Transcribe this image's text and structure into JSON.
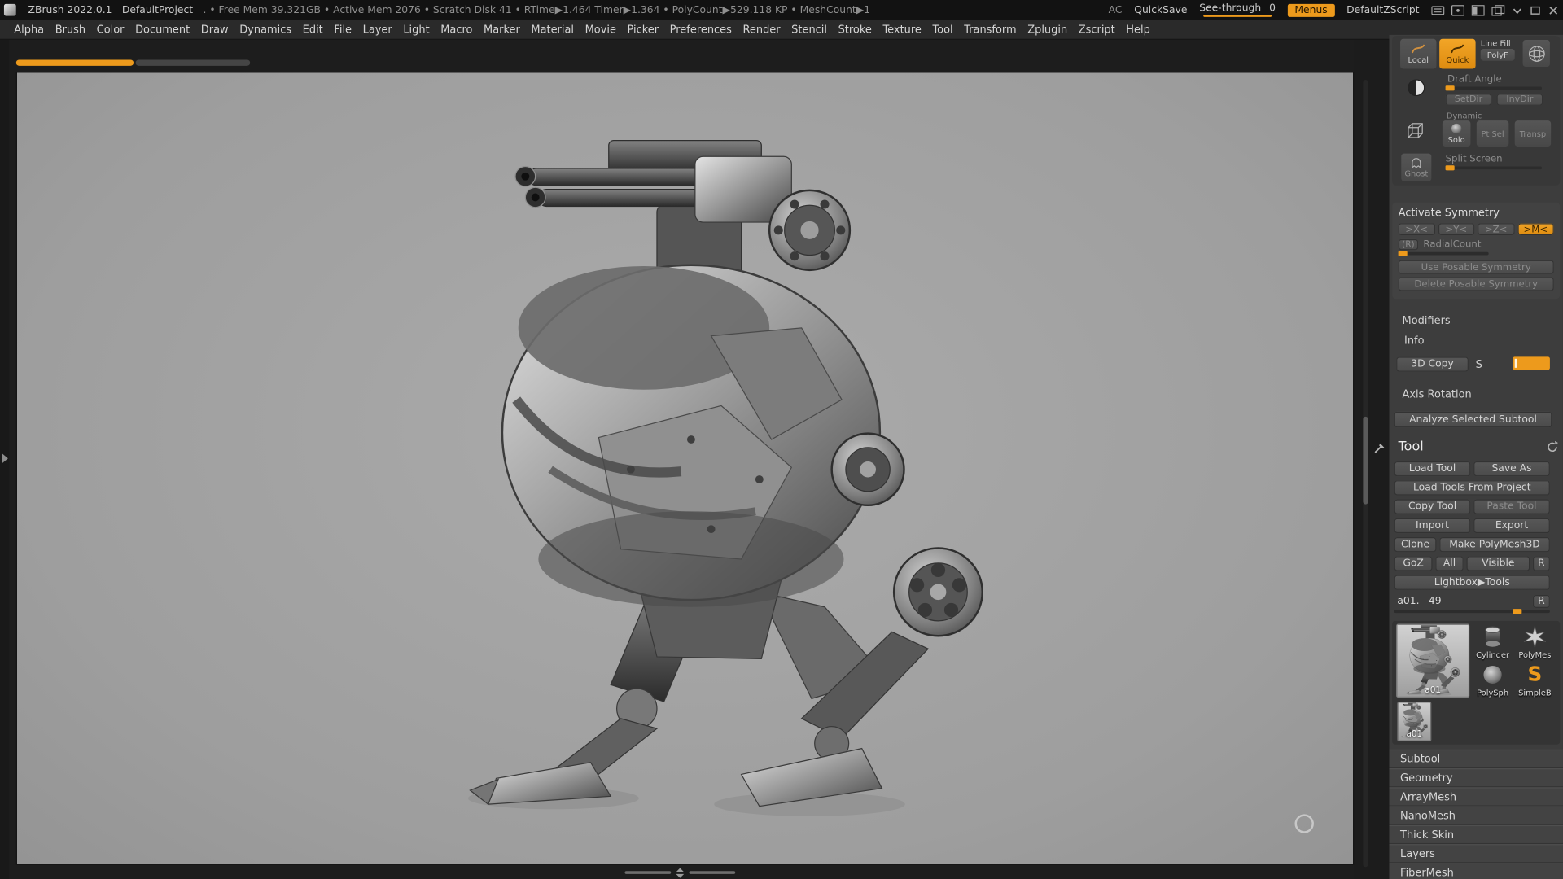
{
  "titlebar": {
    "app_title": "ZBrush 2022.0.1",
    "project_name": "DefaultProject",
    "stats": ". • Free Mem 39.321GB • Active Mem 2076 • Scratch Disk 41 •  RTime▶1.464 Timer▶1.364 • PolyCount▶529.118 KP  • MeshCount▶1",
    "ac_label": "AC",
    "quicksave_label": "QuickSave",
    "seethrough_label": "See-through",
    "seethrough_value": "0",
    "menus_label": "Menus",
    "zscript_label": "DefaultZScript"
  },
  "menubar": {
    "items": [
      "Alpha",
      "Brush",
      "Color",
      "Document",
      "Draw",
      "Dynamics",
      "Edit",
      "File",
      "Layer",
      "Light",
      "Macro",
      "Marker",
      "Material",
      "Movie",
      "Picker",
      "Preferences",
      "Render",
      "Stencil",
      "Stroke",
      "Texture",
      "Tool",
      "Transform",
      "Zplugin",
      "Zscript",
      "Help"
    ]
  },
  "shelf": {
    "local_label": "Local",
    "quick_label": "Quick",
    "line_fill_label": "Line Fill",
    "polyf_label": "PolyF",
    "draft_angle_label": "Draft Angle",
    "setdir_label": "SetDir",
    "invdir_label": "InvDir",
    "dynamic_label": "Dynamic",
    "solo_label": "Solo",
    "ptsel_label": "Pt Sel",
    "transp_label": "Transp",
    "split_screen_label": "Split Screen",
    "ghost_label": "Ghost"
  },
  "symmetry": {
    "header": "Activate Symmetry",
    "x_label": ">X<",
    "y_label": ">Y<",
    "z_label": ">Z<",
    "m_label": ">M<",
    "r_label": "(R)",
    "radial_count_label": "RadialCount",
    "use_posable_label": "Use Posable Symmetry",
    "delete_posable_label": "Delete Posable Symmetry"
  },
  "preview_panel": {
    "modifiers_label": "Modifiers",
    "info_label": "Info",
    "copy3d_label": "3D Copy",
    "s_label": "S",
    "axis_rotation_label": "Axis Rotation",
    "analyze_label": "Analyze Selected Subtool"
  },
  "tool_palette": {
    "title": "Tool",
    "load_tool": "Load Tool",
    "save_as": "Save As",
    "load_from_project": "Load Tools From Project",
    "copy_tool": "Copy Tool",
    "paste_tool": "Paste Tool",
    "import": "Import",
    "export": "Export",
    "clone": "Clone",
    "make_polymesh3d": "Make PolyMesh3D",
    "goz": "GoZ",
    "all": "All",
    "visible": "Visible",
    "r1": "R",
    "lightbox_tools": "Lightbox▶Tools",
    "active_tool_name": "a01.",
    "active_tool_value": "49",
    "r2": "R",
    "thumbnails": {
      "active_large": "a01",
      "cylinder": "Cylinder",
      "polymesh_star": "PolyMes",
      "polysphere": "PolySph",
      "simple_brush": "SimpleB",
      "recent_small": "a01"
    },
    "sections": [
      "Subtool",
      "Geometry",
      "ArrayMesh",
      "NanoMesh",
      "Thick Skin",
      "Layers",
      "FiberMesh"
    ]
  },
  "colors": {
    "accent_orange": "#ED9A1C",
    "tray_bg": "#3D3D3D",
    "canvas_grey": "#A2A2A2",
    "titlebar_bg": "#121212"
  }
}
